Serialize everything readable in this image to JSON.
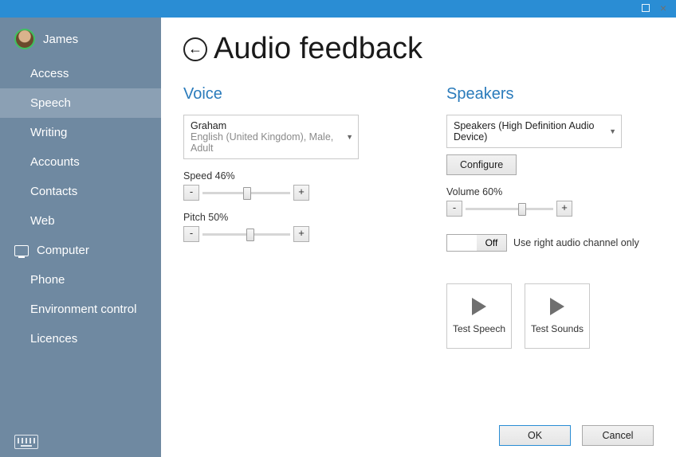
{
  "profile": {
    "name": "James"
  },
  "sidebar": {
    "items": [
      {
        "label": "Access"
      },
      {
        "label": "Speech"
      },
      {
        "label": "Writing"
      },
      {
        "label": "Accounts"
      },
      {
        "label": "Contacts"
      },
      {
        "label": "Web"
      },
      {
        "label": "Computer"
      },
      {
        "label": "Phone"
      },
      {
        "label": "Environment control"
      },
      {
        "label": "Licences"
      }
    ]
  },
  "page": {
    "title": "Audio feedback"
  },
  "voice": {
    "section": "Voice",
    "dropdown_name": "Graham",
    "dropdown_detail": "English (United Kingdom), Male, Adult",
    "speed": {
      "label": "Speed 46%",
      "percent": 46,
      "dec": "-",
      "inc": "+"
    },
    "pitch": {
      "label": "Pitch 50%",
      "percent": 50,
      "dec": "-",
      "inc": "+"
    }
  },
  "speakers": {
    "section": "Speakers",
    "dropdown_name": "Speakers (High Definition Audio Device)",
    "configure": "Configure",
    "volume": {
      "label": "Volume 60%",
      "percent": 60,
      "dec": "-",
      "inc": "+"
    },
    "toggle": {
      "state": "Off",
      "label": "Use right audio channel only"
    },
    "test_speech": "Test Speech",
    "test_sounds": "Test Sounds"
  },
  "footer": {
    "ok": "OK",
    "cancel": "Cancel"
  }
}
